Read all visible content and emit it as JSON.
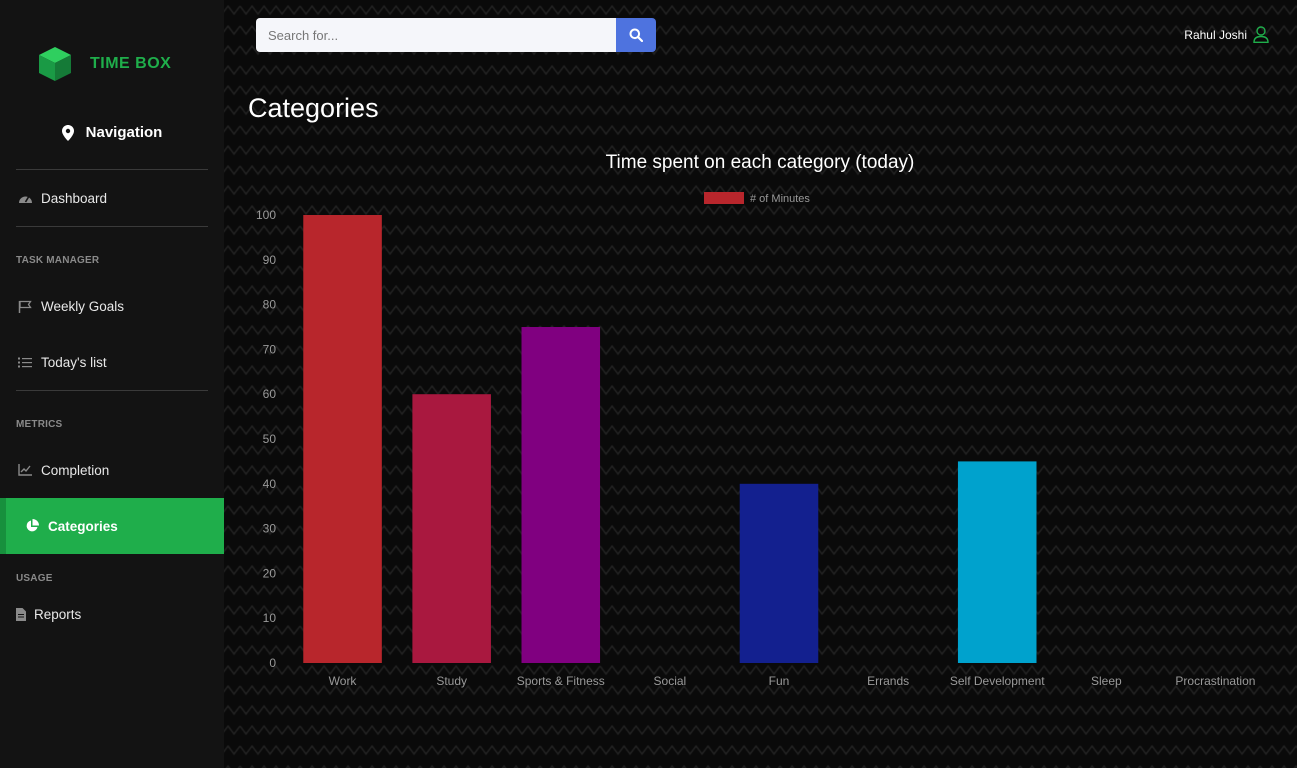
{
  "brand": {
    "name": "TIME BOX"
  },
  "sidebar": {
    "nav_header": "Navigation",
    "dashboard": "Dashboard",
    "sections": {
      "task_manager": "TASK MANAGER",
      "metrics": "METRICS",
      "usage": "USAGE"
    },
    "items": {
      "weekly_goals": "Weekly Goals",
      "todays_list": "Today's list",
      "completion": "Completion",
      "categories": "Categories",
      "reports": "Reports"
    },
    "active_item": "Categories"
  },
  "search": {
    "placeholder": "Search for..."
  },
  "user": {
    "name": "Rahul Joshi"
  },
  "page": {
    "title": "Categories"
  },
  "colors": {
    "accent": "#1fae4b",
    "search_button": "#4e73df"
  },
  "chart_data": {
    "type": "bar",
    "title": "Time spent on each category (today)",
    "legend": {
      "position": "top"
    },
    "ylim": [
      0,
      100
    ],
    "yticks": [
      0,
      10,
      20,
      30,
      40,
      50,
      60,
      70,
      80,
      90,
      100
    ],
    "categories": [
      "Work",
      "Study",
      "Sports & Fitness",
      "Social",
      "Fun",
      "Errands",
      "Self Development",
      "Sleep",
      "Procrastination"
    ],
    "series": [
      {
        "name": "# of Minutes",
        "values": [
          100,
          60,
          75,
          0,
          40,
          0,
          45,
          0,
          0
        ],
        "colors": [
          "#b8262c",
          "#a9183f",
          "#800080",
          "#0c7bc8",
          "#13208f",
          "#1a8f2f",
          "#00a2cd",
          "#666666",
          "#777777"
        ],
        "legend_color": "#b8262c"
      }
    ]
  }
}
